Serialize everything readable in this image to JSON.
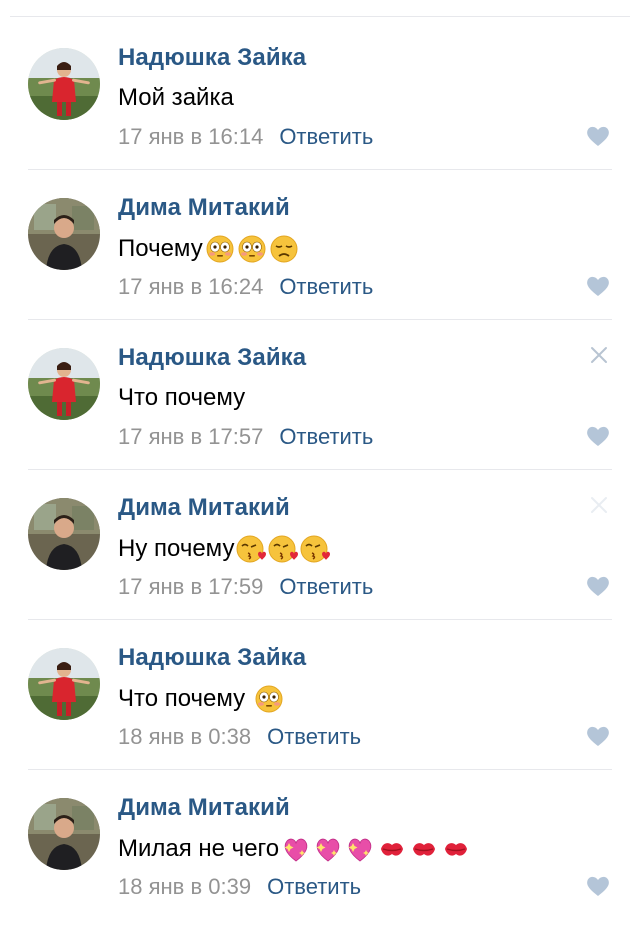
{
  "comments": [
    {
      "author": "Надюшка Зайка",
      "text": "Мой зайка",
      "time": "17 янв в 16:14",
      "reply": "Ответить",
      "emojis": [],
      "avatar": "nadya",
      "close": "none"
    },
    {
      "author": "Дима Митакий",
      "text": "Почему",
      "time": "17 янв в 16:24",
      "reply": "Ответить",
      "emojis": [
        "flushed-face",
        "flushed-face",
        "disappointed-face"
      ],
      "avatar": "dima",
      "close": "none"
    },
    {
      "author": "Надюшка Зайка",
      "text": "Что почему",
      "time": "17 янв в 17:57",
      "reply": "Ответить",
      "emojis": [],
      "avatar": "nadya",
      "close": "visible"
    },
    {
      "author": "Дима Митакий",
      "text": "Ну почему",
      "time": "17 янв в 17:59",
      "reply": "Ответить",
      "emojis": [
        "kissing-heart-face",
        "kissing-heart-face",
        "kissing-heart-face"
      ],
      "avatar": "dima",
      "close": "faint"
    },
    {
      "author": "Надюшка Зайка",
      "text": "Что почему ",
      "time": "18 янв в 0:38",
      "reply": "Ответить",
      "emojis": [
        "flushed-face"
      ],
      "avatar": "nadya",
      "close": "none"
    },
    {
      "author": "Дима Митакий",
      "text": "Милая не чего",
      "time": "18 янв в 0:39",
      "reply": "Ответить",
      "emojis": [
        "sparkling-heart",
        "sparkling-heart",
        "sparkling-heart",
        "kiss-mark",
        "kiss-mark",
        "kiss-mark"
      ],
      "avatar": "dima",
      "close": "none"
    }
  ],
  "colors": {
    "name": "#2a5885",
    "time": "#939393",
    "like": "#b4c5d8",
    "separator": "#e7e8ec"
  }
}
